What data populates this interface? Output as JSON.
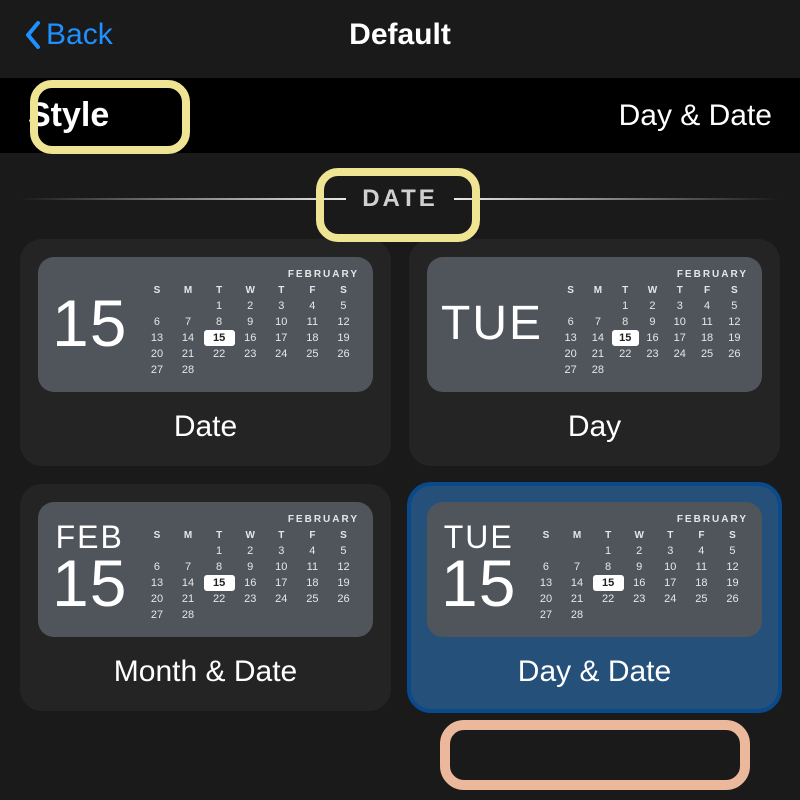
{
  "nav": {
    "back_label": "Back",
    "title": "Default"
  },
  "settings": {
    "label": "Style",
    "value": "Day & Date"
  },
  "section": {
    "label": "DATE"
  },
  "calendar": {
    "month_label": "FEBRUARY",
    "headers": [
      "S",
      "M",
      "T",
      "W",
      "T",
      "F",
      "S"
    ],
    "rows": [
      [
        "",
        "",
        "1",
        "2",
        "3",
        "4",
        "5"
      ],
      [
        "6",
        "7",
        "8",
        "9",
        "10",
        "11",
        "12"
      ],
      [
        "13",
        "14",
        "15",
        "16",
        "17",
        "18",
        "19"
      ],
      [
        "20",
        "21",
        "22",
        "23",
        "24",
        "25",
        "26"
      ],
      [
        "27",
        "28",
        "",
        "",
        "",
        "",
        ""
      ]
    ],
    "highlight_day": "15"
  },
  "options": [
    {
      "key": "date",
      "label": "Date",
      "left_top": "",
      "left_main": "15",
      "selected": false
    },
    {
      "key": "day",
      "label": "Day",
      "left_top": "",
      "left_main": "TUE",
      "selected": false
    },
    {
      "key": "month-date",
      "label": "Month & Date",
      "left_top": "FEB",
      "left_main": "15",
      "selected": false
    },
    {
      "key": "day-date",
      "label": "Day & Date",
      "left_top": "TUE",
      "left_main": "15",
      "selected": true
    }
  ]
}
